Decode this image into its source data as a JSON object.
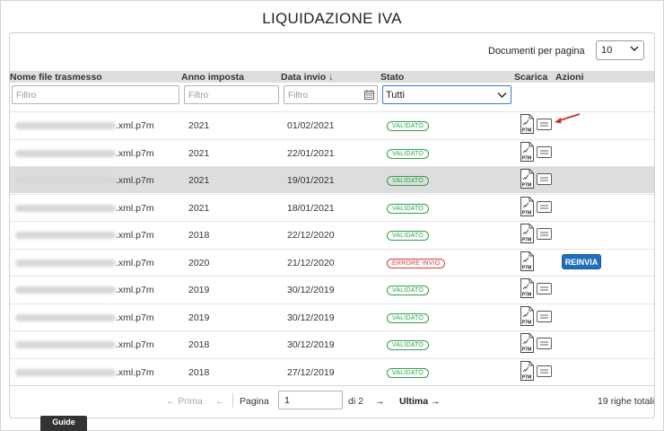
{
  "page": {
    "title": "LIQUIDAZIONE IVA"
  },
  "toolbar": {
    "per_page_label": "Documenti per pagina",
    "per_page_value": "10"
  },
  "table": {
    "headers": {
      "filename": "Nome file trasmesso",
      "year": "Anno imposta",
      "date": "Data invio",
      "date_sort": "↓",
      "status": "Stato",
      "download": "Scarica",
      "actions": "Azioni"
    },
    "filters": {
      "filename_placeholder": "Filtro",
      "year_placeholder": "Filtro",
      "date_placeholder": "Filtro",
      "status_value": "Tutti"
    },
    "rows": [
      {
        "filename_suffix": ".xml.p7m",
        "year": "2021",
        "date": "01/02/2021",
        "status": "VALIDATO",
        "status_type": "ok",
        "action": ""
      },
      {
        "filename_suffix": ".xml.p7m",
        "year": "2021",
        "date": "22/01/2021",
        "status": "VALIDATO",
        "status_type": "ok",
        "action": ""
      },
      {
        "filename_suffix": ".xml.p7m",
        "year": "2021",
        "date": "19/01/2021",
        "status": "VALIDATO",
        "status_type": "ok",
        "action": ""
      },
      {
        "filename_suffix": ".xml.p7m",
        "year": "2021",
        "date": "18/01/2021",
        "status": "VALIDATO",
        "status_type": "ok",
        "action": ""
      },
      {
        "filename_suffix": ".xml.p7m",
        "year": "2018",
        "date": "22/12/2020",
        "status": "VALIDATO",
        "status_type": "ok",
        "action": ""
      },
      {
        "filename_suffix": ".xml.p7m",
        "year": "2020",
        "date": "21/12/2020",
        "status": "ERRORE INVIO",
        "status_type": "err",
        "action": "REINVIA"
      },
      {
        "filename_suffix": ".xml.p7m",
        "year": "2019",
        "date": "30/12/2019",
        "status": "VALIDATO",
        "status_type": "ok",
        "action": ""
      },
      {
        "filename_suffix": ".xml.p7m",
        "year": "2019",
        "date": "30/12/2019",
        "status": "VALIDATO",
        "status_type": "ok",
        "action": ""
      },
      {
        "filename_suffix": ".xml.p7m",
        "year": "2018",
        "date": "30/12/2019",
        "status": "VALIDATO",
        "status_type": "ok",
        "action": ""
      },
      {
        "filename_suffix": ".xml.p7m",
        "year": "2018",
        "date": "27/12/2019",
        "status": "VALIDATO",
        "status_type": "ok",
        "action": ""
      }
    ],
    "icon_label": "P7M"
  },
  "pagination": {
    "first": "← Prima",
    "prev": "←",
    "page_label": "Pagina",
    "page_value": "1",
    "of_label": "di 2",
    "next": "→",
    "last": "Ultima →",
    "total": "19 righe totali"
  },
  "guide": {
    "label": "Guide"
  },
  "colors": {
    "ok": "#2ca24a",
    "err": "#d93a3a",
    "button": "#1f6fbf",
    "highlight": "#dddddd"
  }
}
